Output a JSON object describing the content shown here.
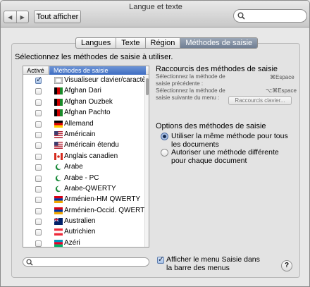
{
  "window": {
    "title": "Langue et texte"
  },
  "toolbar": {
    "back_icon": "back-arrow-icon",
    "forward_icon": "forward-arrow-icon",
    "show_all_label": "Tout afficher",
    "search_placeholder": ""
  },
  "tabs": [
    {
      "label": "Langues",
      "active": false
    },
    {
      "label": "Texte",
      "active": false
    },
    {
      "label": "Région",
      "active": false
    },
    {
      "label": "Méthodes de saisie",
      "active": true
    }
  ],
  "instruction": "Sélectionnez les méthodes de saisie à utiliser.",
  "list": {
    "headers": {
      "enabled": "Activé",
      "method": "Méthodes de saisie"
    },
    "rows": [
      {
        "label": "Visualiseur clavier/caractères",
        "checked": true,
        "icon": "keyboard-viewer-icon"
      },
      {
        "label": "Afghan Dari",
        "checked": false,
        "icon": "flag-afghanistan-icon"
      },
      {
        "label": "Afghan Ouzbek",
        "checked": false,
        "icon": "flag-afghanistan-icon"
      },
      {
        "label": "Afghan Pachto",
        "checked": false,
        "icon": "flag-afghanistan-icon"
      },
      {
        "label": "Allemand",
        "checked": false,
        "icon": "flag-germany-icon"
      },
      {
        "label": "Américain",
        "checked": false,
        "icon": "flag-usa-icon"
      },
      {
        "label": "Américain étendu",
        "checked": false,
        "icon": "flag-usa-icon"
      },
      {
        "label": "Anglais canadien",
        "checked": false,
        "icon": "flag-canada-icon"
      },
      {
        "label": "Arabe",
        "checked": false,
        "icon": "crescent-icon"
      },
      {
        "label": "Arabe - PC",
        "checked": false,
        "icon": "crescent-icon"
      },
      {
        "label": "Arabe-QWERTY",
        "checked": false,
        "icon": "crescent-icon"
      },
      {
        "label": "Arménien-HM QWERTY",
        "checked": false,
        "icon": "flag-armenia-icon"
      },
      {
        "label": "Arménien-Occid. QWERTY",
        "checked": false,
        "icon": "flag-armenia-icon"
      },
      {
        "label": "Australien",
        "checked": false,
        "icon": "flag-australia-icon"
      },
      {
        "label": "Autrichien",
        "checked": false,
        "icon": "flag-austria-icon"
      },
      {
        "label": "Azéri",
        "checked": false,
        "icon": "flag-azerbaijan-icon"
      }
    ]
  },
  "shortcuts": {
    "title": "Raccourcis des méthodes de saisie",
    "prev_label": "Sélectionnez la méthode de saisie précédente :",
    "prev_key": "⌘Espace",
    "next_label": "Sélectionnez la méthode de saisie suivante du menu :",
    "next_key": "⌥⌘Espace",
    "keyboard_button": "Raccourcis clavier..."
  },
  "options": {
    "title": "Options des méthodes de saisie",
    "radio_same": "Utiliser la même méthode pour tous les documents",
    "radio_different": "Autoriser une méthode différente pour chaque document",
    "selected": "same"
  },
  "show_menu": {
    "label": "Afficher le menu Saisie dans la barre des menus",
    "checked": true
  },
  "help": {
    "label": "?"
  },
  "colors": {
    "selection_blue": "#3d6cc2",
    "tab_active": "#7a889c"
  }
}
